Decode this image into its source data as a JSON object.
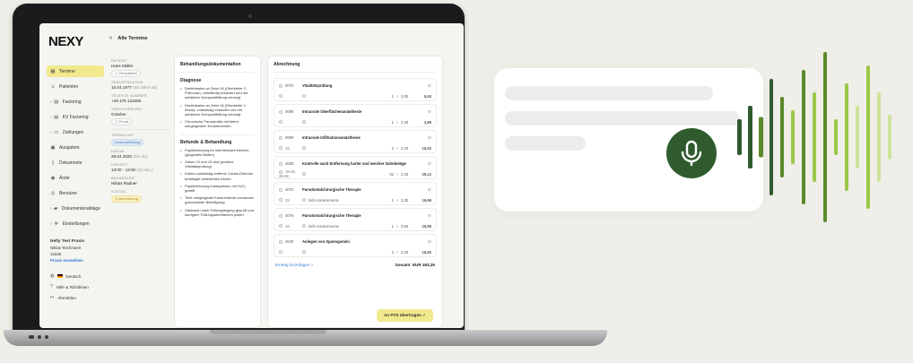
{
  "app": {
    "logo": "NEXY"
  },
  "sidebar": {
    "items": [
      {
        "label": "Termine",
        "icon": "calendar-icon",
        "active": true,
        "chevron": false
      },
      {
        "label": "Patienten",
        "icon": "users-icon",
        "active": false,
        "chevron": false
      },
      {
        "label": "Factoring",
        "icon": "document-icon",
        "active": false,
        "chevron": true
      },
      {
        "label": "KV Factoring",
        "icon": "document-icon",
        "active": false,
        "chevron": true
      },
      {
        "label": "Zahlungen",
        "icon": "card-icon",
        "active": false,
        "chevron": true
      },
      {
        "label": "Ausgaben",
        "icon": "wallet-icon",
        "active": false,
        "chevron": false
      },
      {
        "label": "Dokumente",
        "icon": "file-icon",
        "active": false,
        "chevron": false
      },
      {
        "label": "Ärzte",
        "icon": "eye-icon",
        "active": false,
        "chevron": false
      },
      {
        "label": "Benutzer",
        "icon": "user-icon",
        "active": false,
        "chevron": false
      },
      {
        "label": "Dokumentenablage",
        "icon": "folder-icon",
        "active": false,
        "chevron": true
      },
      {
        "label": "Einstellungen",
        "icon": "gear-icon",
        "active": false,
        "chevron": true
      }
    ],
    "org": {
      "name": "Nelly Test Praxis",
      "user": "Niklas Teichmann",
      "number": "12345",
      "link": "Praxis auswählen"
    },
    "footer": {
      "language": "Deutsch",
      "help": "Hilfe & Richtlinien",
      "logout": "Abmelden"
    }
  },
  "topbar": {
    "back": "<",
    "title": "Alle Termine"
  },
  "patient": {
    "patient_label": "PATIENT",
    "name": "Hans Müller",
    "type": "Neupatient",
    "birth_label": "GEBURTSDATUM",
    "birth": "15.04.1977",
    "birth_age": "(48 Jahre alt)",
    "phone_label": "TELEFON NUMMER",
    "phone": "+49 176 123456",
    "insurance_label": "VERSICHERUNG",
    "insurance": "Gotaher",
    "insurance_type": "Privat",
    "appt_label": "TERMIN ART",
    "appt": "Kompositfüllung",
    "date_label": "DATUM",
    "date": "28.04.2025",
    "date_day": "(Mo Ab)",
    "time_label": "UHRZEIT",
    "time": "13:00 - 13:30",
    "time_dur": "(30 Min.)",
    "doctor_label": "BEHANDLER",
    "doctor": "Niklas Radner",
    "status_label": "STATUS",
    "status": "Abrechnung"
  },
  "behandlung": {
    "title": "Behandlungsdokumentation",
    "diagnose_title": "Diagnose",
    "diagnose": [
      "Dentinkaries an Zahn 15 (Oberkiefer 2. Prämolar), vollständig exkaviert und mit adhäsiver Kompositfüllung versorgt",
      "Dentinkaries an Zahn 16 (Oberkiefer 1. Molar), vollständig exkaviert und mit adhäsiver Kompositfüllung versorgt",
      "Chronische Parodontitis mit tiefen subgingivalen Konkrementen"
    ],
    "befunde_title": "Befunde & Behandlung",
    "befunde": [
      "Papillenblutung im interdentalen Bereich (gingivales Bluten)",
      "Zähne 15 und 16 vital (positive Vitalitätsprüfung)",
      "Karies vollständig entfernt; Caries-Detector bestätigte kariesfreies Dentin",
      "Papillenblutung intraoperativ, mit H₂O₂ gestillt",
      "Tiefe subgingivale Konkremente vorhanden (parodontale Beteiligung)",
      "Okklusion nach Füllungslegung geprüft und korrigiert; Füllungsoberflächen poliert"
    ]
  },
  "abrechnung": {
    "title": "Abrechnung",
    "rows": [
      {
        "code": "0070",
        "desc": "Vitalitätsprüfung",
        "date": "",
        "extra": "",
        "qty": "1",
        "factor": "2,00",
        "amount": "5,63"
      },
      {
        "code": "0080",
        "desc": "Intraorale Oberflächenanästhesie",
        "date": "",
        "extra": "",
        "qty": "1",
        "factor": "2,30",
        "amount": "3,86"
      },
      {
        "code": "0090",
        "desc": "Intraorale Infiltrationsanästhesie",
        "date": "15",
        "extra": "",
        "qty": "2",
        "factor": "2,30",
        "amount": "15,52"
      },
      {
        "code": "4060",
        "desc": "Kontrolle nach Entfernung harter und weicher Zahnbeläge",
        "date": "18-28, 38-48",
        "extra": "",
        "qty": "32",
        "factor": "2,30",
        "amount": "29,12"
      },
      {
        "code": "4070",
        "desc": "Parodontalchirurgische Therapie",
        "date": "15",
        "extra": "tiefe Konkremente",
        "qty": "1",
        "factor": "3,30",
        "amount": "19,68"
      },
      {
        "code": "4075",
        "desc": "Parodontalchirurgische Therapie",
        "date": "16",
        "extra": "tiefe Konkremente",
        "qty": "1",
        "factor": "3,50",
        "amount": "25,59"
      },
      {
        "code": "2040",
        "desc": "Anlegen von Spanngummi",
        "date": "",
        "extra": "",
        "qty": "2",
        "factor": "2,30",
        "amount": "16,82"
      }
    ],
    "add_label": "Eintrag hinzufügen",
    "total_label": "Gesamt",
    "total_currency": "EUR",
    "total": "453,25",
    "transfer_label": "An PVS übertragen"
  },
  "voice": {
    "mic_icon": "microphone-icon",
    "accent": "#2f5b2f",
    "wave_colors": [
      "#2f5b2f",
      "#5a8a2a",
      "#9bc84a",
      "#cde39a"
    ]
  }
}
